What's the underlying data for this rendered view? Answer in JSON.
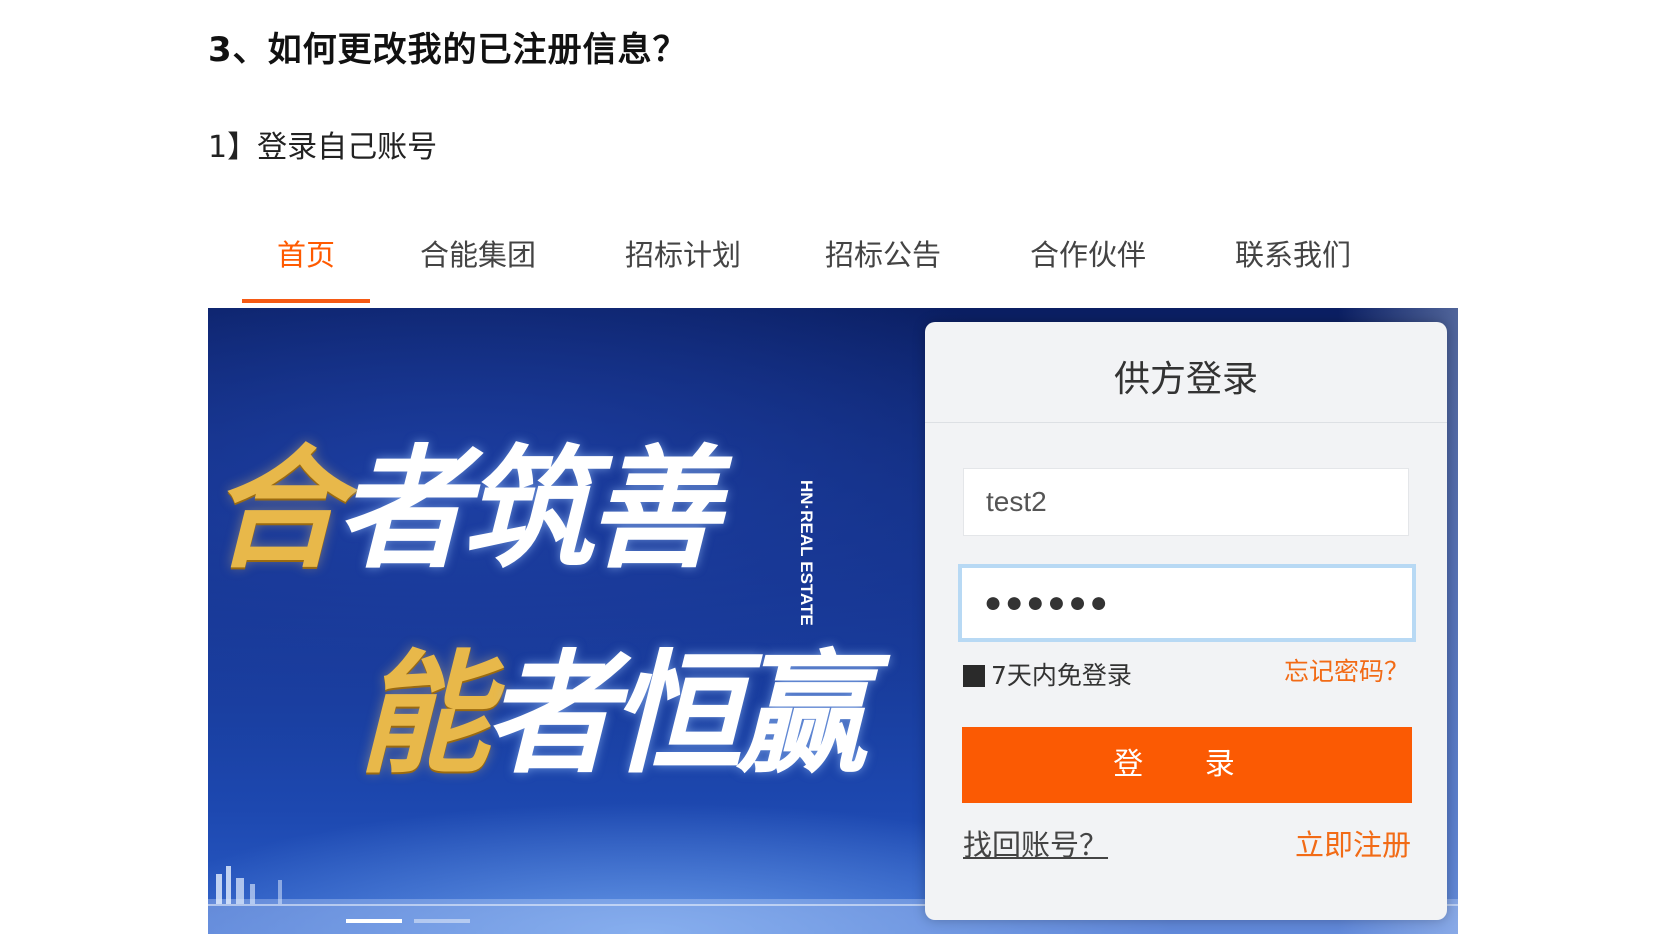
{
  "doc": {
    "heading": "3、如何更改我的已注册信息？",
    "step": "1】登录自己账号"
  },
  "nav": {
    "items": [
      "首页",
      "合能集团",
      "招标计划",
      "招标公告",
      "合作伙伴",
      "联系我们"
    ],
    "active_index": 0
  },
  "banner": {
    "slogan_line1_gold": "合",
    "slogan_line1_white": "者筑善",
    "slogan_line2_gold": "能",
    "slogan_line2_white": "者恒赢",
    "brand_line1": "HN·REAL",
    "brand_line2": "ESTATE",
    "carousel_active_index": 0
  },
  "login": {
    "title": "供方登录",
    "username_value": "test2",
    "password_mask": "●●●●●●",
    "remember_label": "7天内免登录",
    "forgot_label": "忘记密码？",
    "submit_label": "登 录",
    "recover_label": "找回账号？",
    "register_label": "立即注册"
  },
  "colors": {
    "accent": "#fb5a03",
    "link_orange": "#f26b16",
    "banner_blue": "#15348e",
    "gold": "#e8b84a"
  }
}
